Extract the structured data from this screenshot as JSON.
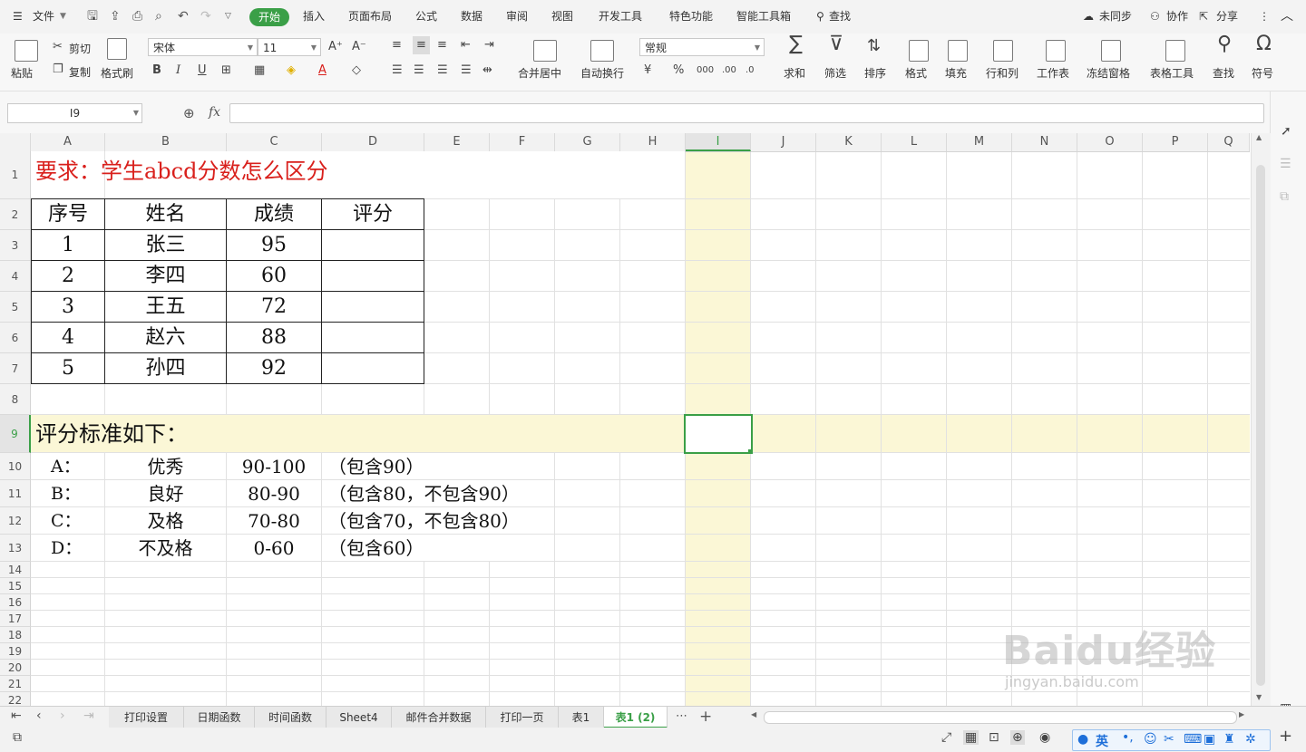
{
  "menubar": {
    "file": "文件",
    "tabs": [
      "开始",
      "插入",
      "页面布局",
      "公式",
      "数据",
      "审阅",
      "视图",
      "开发工具",
      "特色功能",
      "智能工具箱"
    ],
    "active_tab": "开始",
    "search": "查找",
    "sync": "未同步",
    "collab": "协作",
    "share": "分享"
  },
  "ribbon": {
    "paste": "粘贴",
    "cut": "剪切",
    "copy": "复制",
    "format_painter": "格式刷",
    "font_name": "宋体",
    "font_size": "11",
    "merge_center": "合并居中",
    "auto_wrap": "自动换行",
    "number_format": "常规",
    "sum": "求和",
    "filter": "筛选",
    "sort": "排序",
    "format": "格式",
    "fill": "填充",
    "rows_cols": "行和列",
    "worksheet": "工作表",
    "freeze": "冻结窗格",
    "table_tools": "表格工具",
    "find": "查找",
    "symbol": "符号",
    "bold": "B",
    "italic": "I",
    "underline": "U"
  },
  "formula_bar": {
    "cell_ref": "I9",
    "fx": "fx",
    "value": ""
  },
  "columns": [
    "A",
    "B",
    "C",
    "D",
    "E",
    "F",
    "G",
    "H",
    "I",
    "J",
    "K",
    "L",
    "M",
    "N",
    "O",
    "P",
    "Q"
  ],
  "rows": [
    "1",
    "2",
    "3",
    "4",
    "5",
    "6",
    "7",
    "8",
    "9",
    "10",
    "11",
    "12",
    "13",
    "14",
    "15",
    "16",
    "17",
    "18",
    "19",
    "20",
    "21",
    "22"
  ],
  "sheet": {
    "title": "要求：学生abcd分数怎么区分",
    "table_headers": [
      "序号",
      "姓名",
      "成绩",
      "评分"
    ],
    "table_rows": [
      [
        "1",
        "张三",
        "95",
        ""
      ],
      [
        "2",
        "李四",
        "60",
        ""
      ],
      [
        "3",
        "王五",
        "72",
        ""
      ],
      [
        "4",
        "赵六",
        "88",
        ""
      ],
      [
        "5",
        "孙四",
        "92",
        ""
      ]
    ],
    "criteria_title": "评分标准如下：",
    "criteria": [
      [
        "A：",
        "优秀",
        "90-100",
        "（包含90）"
      ],
      [
        "B：",
        "良好",
        "80-90",
        "（包含80，不包含90）"
      ],
      [
        "C：",
        "及格",
        "70-80",
        "（包含70，不包含80）"
      ],
      [
        "D：",
        "不及格",
        "0-60",
        "（包含60）"
      ]
    ]
  },
  "sheet_tabs": [
    "打印设置",
    "日期函数",
    "时间函数",
    "Sheet4",
    "邮件合并数据",
    "打印一页",
    "表1",
    "表1 (2)"
  ],
  "active_sheet": "表1 (2)",
  "status": {
    "ime": "英"
  },
  "watermark": "Baidu经验 jingyan.baidu.com",
  "colors": {
    "accent_green": "#3a9f47",
    "highlight_yellow": "#fbf7d6",
    "title_red": "#d9201c"
  }
}
